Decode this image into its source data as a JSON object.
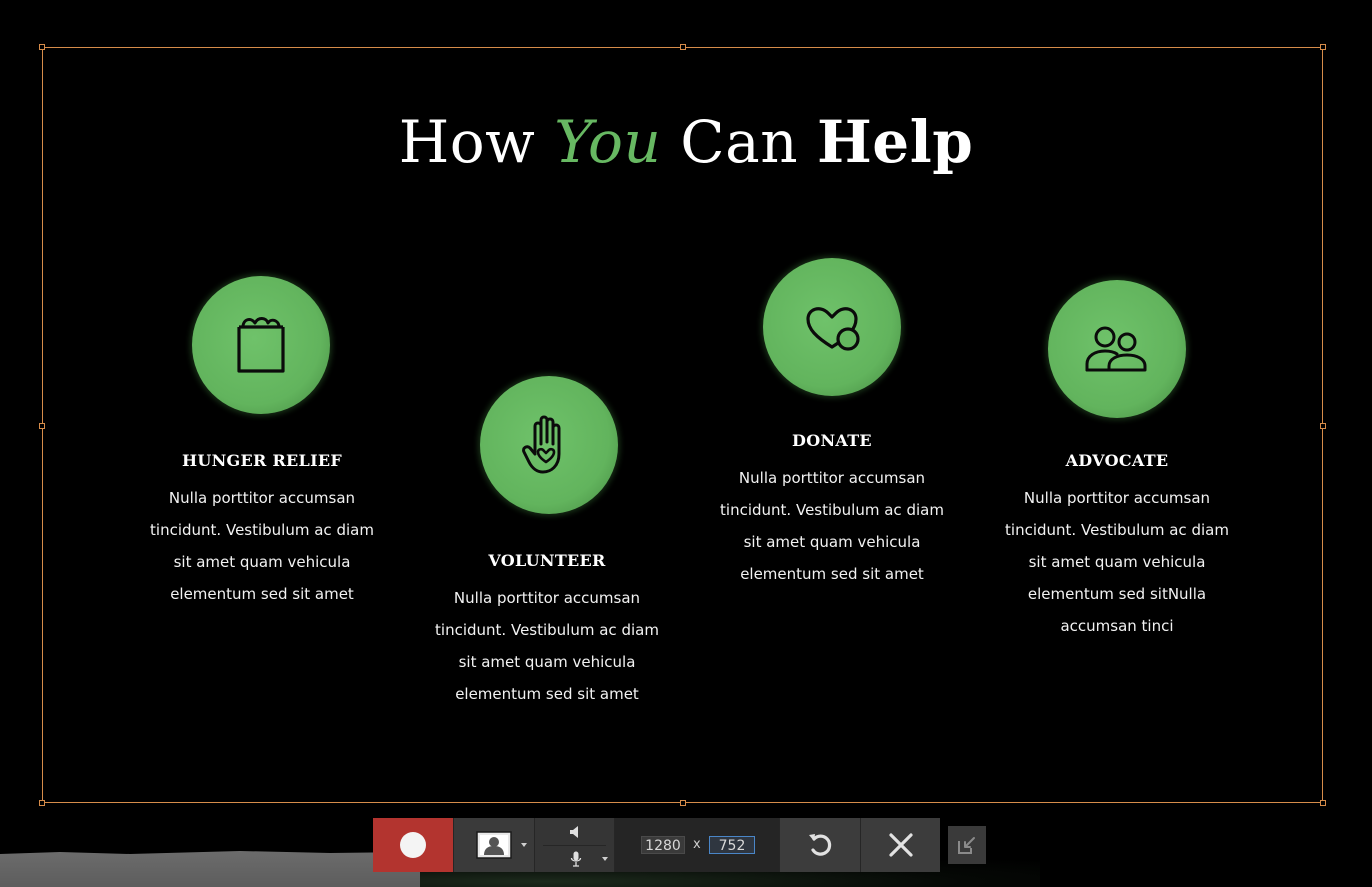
{
  "heading": {
    "part1": "How ",
    "part2": "You",
    "part3": " Can ",
    "part4": "Help"
  },
  "features": [
    {
      "title": "HUNGER RELIEF",
      "icon": "grocery-bag-icon",
      "lines": [
        "Nulla porttitor accumsan",
        "tincidunt. Vestibulum ac diam",
        "sit amet quam vehicula",
        "elementum sed sit amet"
      ]
    },
    {
      "title": "VOLUNTEER",
      "icon": "hand-heart-icon",
      "lines": [
        "Nulla porttitor accumsan",
        "tincidunt. Vestibulum ac diam",
        "sit amet quam vehicula",
        "elementum sed sit amet"
      ]
    },
    {
      "title": "DONATE",
      "icon": "heart-coin-icon",
      "lines": [
        "Nulla porttitor accumsan",
        "tincidunt. Vestibulum ac diam",
        "sit amet quam vehicula",
        "elementum sed sit amet"
      ]
    },
    {
      "title": "ADVOCATE",
      "icon": "people-icon",
      "lines": [
        "Nulla porttitor accumsan",
        "tincidunt. Vestibulum ac diam",
        "sit amet quam vehicula",
        "elementum sed sitNulla",
        "accumsan tinci"
      ]
    }
  ],
  "toolbar": {
    "width_value": "1280",
    "separator": "x",
    "height_value": "752",
    "icons": {
      "record": "record-icon",
      "webcam": "webcam-icon",
      "speaker": "speaker-icon",
      "microphone": "microphone-icon",
      "reset": "reset-icon",
      "close": "close-icon",
      "undock": "undock-icon"
    }
  },
  "colors": {
    "accent_green": "#67b862",
    "selection_frame": "#d68c4a",
    "record_red": "#b3342f",
    "background": "#000000"
  }
}
